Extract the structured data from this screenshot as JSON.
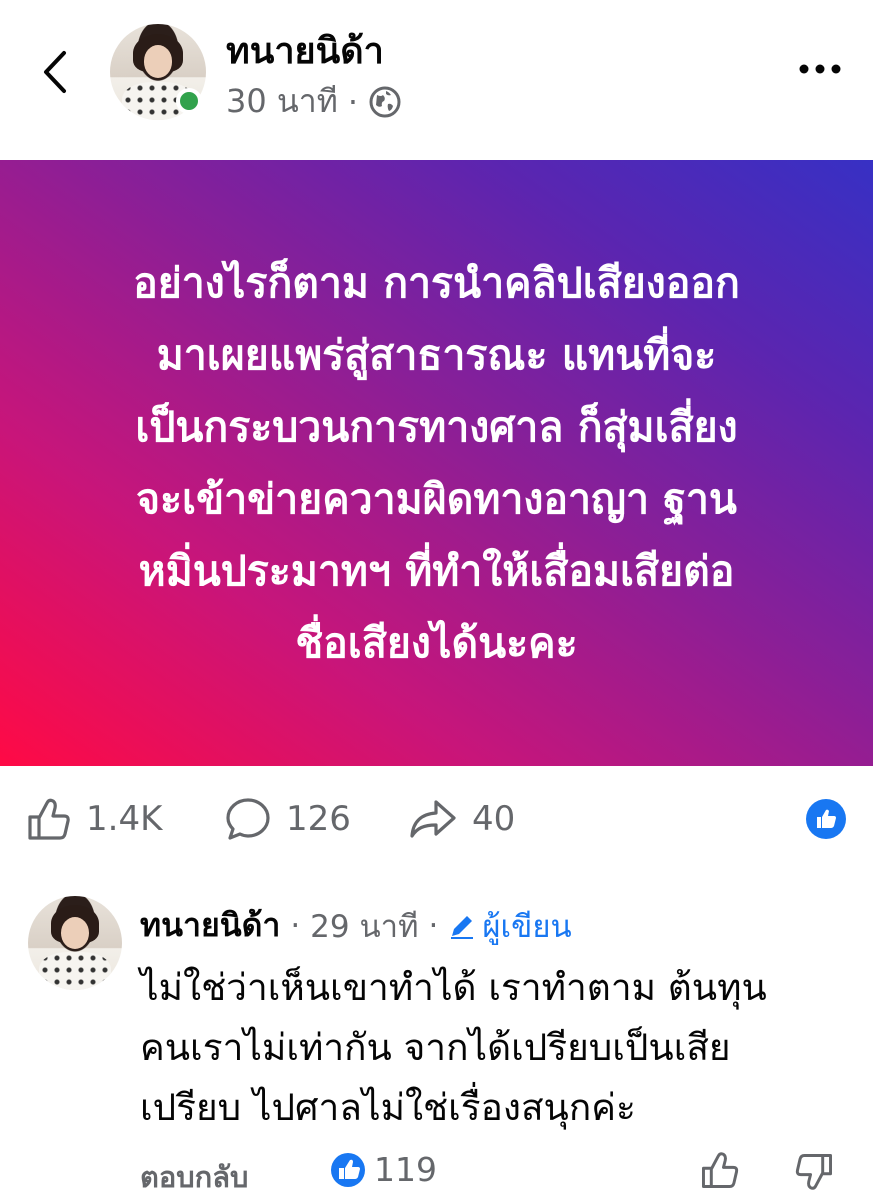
{
  "header": {
    "author_name": "ทนายนิด้า",
    "time": "30 นาที",
    "separator": "·",
    "privacy_icon": "globe-icon",
    "back_icon": "chevron-left-icon",
    "more_icon": "more-dots-icon"
  },
  "post": {
    "banner_text": "อย่างไรก็ตาม การนำคลิปเสียงออก\nมาเผยแพร่สู่สาธารณะ แทนที่จะ\nเป็นกระบวนการทางศาล ก็สุ่มเสี่ยง\nจะเข้าข่ายความผิดทางอาญา ฐาน\nหมิ่นประมาทฯ ที่ทำให้เสื่อมเสียต่อ\nชื่อเสียงได้นะคะ",
    "banner_gradient_colors": [
      "#ff0a45",
      "#8a1f97",
      "#3730c4"
    ]
  },
  "stats": {
    "likes": "1.4K",
    "comments": "126",
    "shares": "40"
  },
  "comment": {
    "author": "ทนายนิด้า",
    "separator": "·",
    "time": "29 นาที",
    "author_badge": "ผู้เขียน",
    "text": "ไม่ใช่ว่าเห็นเขาทำได้ เราทำตาม ต้นทุน\nคนเราไม่เท่ากัน จากได้เปรียบเป็นเสีย\nเปรียบ ไปศาลไม่ใช่เรื่องสนุกค่ะ",
    "reply_label": "ตอบกลับ",
    "reaction_count": "119"
  },
  "colors": {
    "accent": "#1877f2",
    "online": "#31a24c",
    "secondary_text": "#65676b"
  }
}
